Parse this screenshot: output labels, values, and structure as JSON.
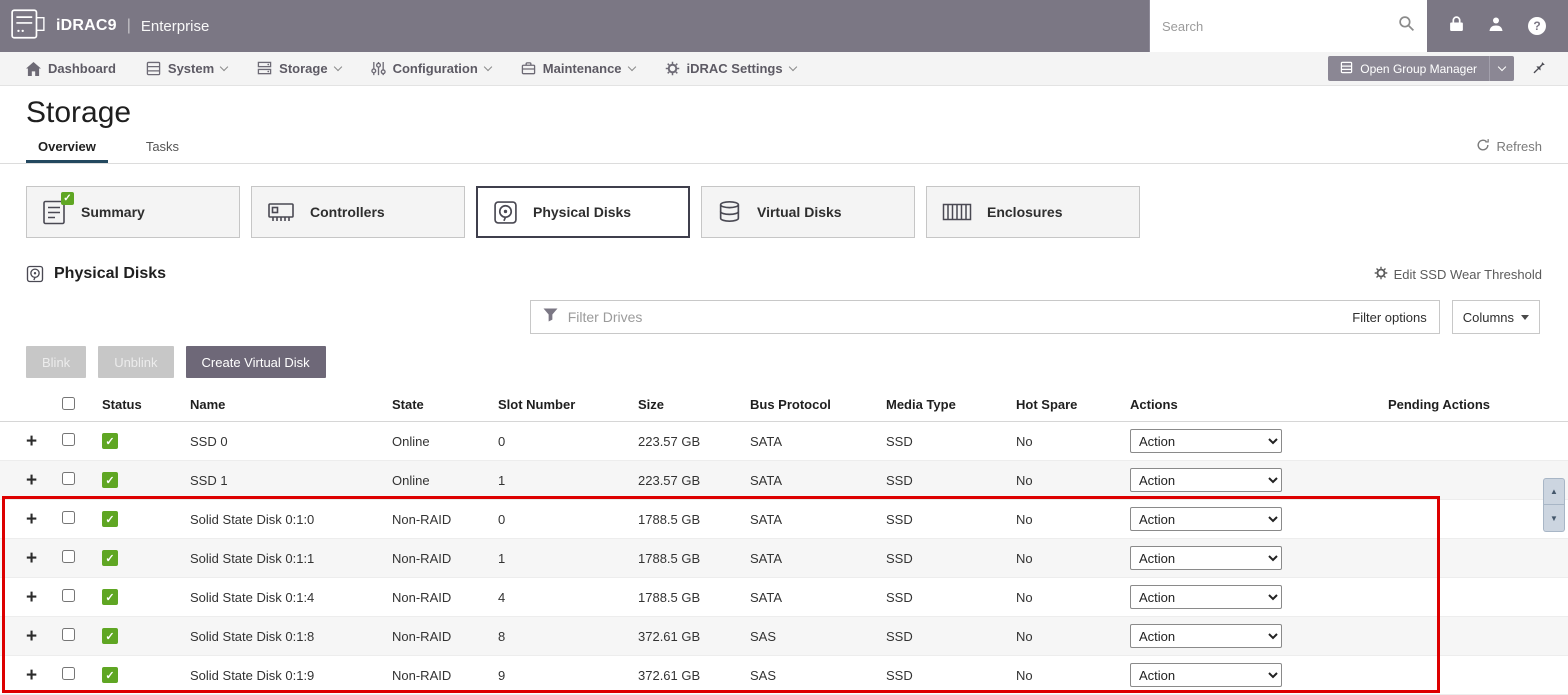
{
  "topbar": {
    "brand": "iDRAC9",
    "separator": "|",
    "edition": "Enterprise",
    "search_placeholder": "Search"
  },
  "nav": {
    "items": [
      {
        "label": "Dashboard",
        "icon": "home-icon",
        "has_dropdown": false
      },
      {
        "label": "System",
        "icon": "system-icon",
        "has_dropdown": true
      },
      {
        "label": "Storage",
        "icon": "storage-icon",
        "has_dropdown": true
      },
      {
        "label": "Configuration",
        "icon": "configuration-icon",
        "has_dropdown": true
      },
      {
        "label": "Maintenance",
        "icon": "maintenance-icon",
        "has_dropdown": true
      },
      {
        "label": "iDRAC Settings",
        "icon": "gear-icon",
        "has_dropdown": true
      }
    ],
    "open_group_manager_label": "Open Group Manager"
  },
  "page": {
    "title": "Storage",
    "tabs": [
      {
        "label": "Overview",
        "active": true
      },
      {
        "label": "Tasks",
        "active": false
      }
    ],
    "refresh_label": "Refresh"
  },
  "cards": [
    {
      "label": "Summary",
      "icon": "summary-icon",
      "status_badge": true,
      "selected": false
    },
    {
      "label": "Controllers",
      "icon": "controllers-icon",
      "status_badge": false,
      "selected": false
    },
    {
      "label": "Physical Disks",
      "icon": "physical-disks-icon",
      "status_badge": false,
      "selected": true
    },
    {
      "label": "Virtual Disks",
      "icon": "virtual-disks-icon",
      "status_badge": false,
      "selected": false
    },
    {
      "label": "Enclosures",
      "icon": "enclosures-icon",
      "status_badge": false,
      "selected": false
    }
  ],
  "section": {
    "title": "Physical Disks",
    "edit_ssd_wear_threshold_label": "Edit SSD Wear Threshold"
  },
  "filter": {
    "placeholder": "Filter Drives",
    "options_label": "Filter options",
    "columns_label": "Columns"
  },
  "toolbar": {
    "blink_label": "Blink",
    "unblink_label": "Unblink",
    "create_virtual_disk_label": "Create Virtual Disk"
  },
  "table": {
    "headers": [
      "Status",
      "Name",
      "State",
      "Slot Number",
      "Size",
      "Bus Protocol",
      "Media Type",
      "Hot Spare",
      "Actions",
      "Pending Actions"
    ],
    "action_select_value": "Action",
    "rows": [
      {
        "status": "ok",
        "name": "SSD 0",
        "state": "Online",
        "slot_number": "0",
        "size": "223.57 GB",
        "bus_protocol": "SATA",
        "media_type": "SSD",
        "hot_spare": "No",
        "action": "Action",
        "pending_actions": ""
      },
      {
        "status": "ok",
        "name": "SSD 1",
        "state": "Online",
        "slot_number": "1",
        "size": "223.57 GB",
        "bus_protocol": "SATA",
        "media_type": "SSD",
        "hot_spare": "No",
        "action": "Action",
        "pending_actions": ""
      },
      {
        "status": "ok",
        "name": "Solid State Disk 0:1:0",
        "state": "Non-RAID",
        "slot_number": "0",
        "size": "1788.5 GB",
        "bus_protocol": "SATA",
        "media_type": "SSD",
        "hot_spare": "No",
        "action": "Action",
        "pending_actions": ""
      },
      {
        "status": "ok",
        "name": "Solid State Disk 0:1:1",
        "state": "Non-RAID",
        "slot_number": "1",
        "size": "1788.5 GB",
        "bus_protocol": "SATA",
        "media_type": "SSD",
        "hot_spare": "No",
        "action": "Action",
        "pending_actions": ""
      },
      {
        "status": "ok",
        "name": "Solid State Disk 0:1:4",
        "state": "Non-RAID",
        "slot_number": "4",
        "size": "1788.5 GB",
        "bus_protocol": "SATA",
        "media_type": "SSD",
        "hot_spare": "No",
        "action": "Action",
        "pending_actions": ""
      },
      {
        "status": "ok",
        "name": "Solid State Disk 0:1:8",
        "state": "Non-RAID",
        "slot_number": "8",
        "size": "372.61 GB",
        "bus_protocol": "SAS",
        "media_type": "SSD",
        "hot_spare": "No",
        "action": "Action",
        "pending_actions": ""
      },
      {
        "status": "ok",
        "name": "Solid State Disk 0:1:9",
        "state": "Non-RAID",
        "slot_number": "9",
        "size": "372.61 GB",
        "bus_protocol": "SAS",
        "media_type": "SSD",
        "hot_spare": "No",
        "action": "Action",
        "pending_actions": ""
      }
    ]
  },
  "annotation": {
    "highlight_color": "#dd0000"
  },
  "colors": {
    "topbar_bg": "#7b7784",
    "tab_underline": "#23485f",
    "status_green": "#5fa623",
    "primary_button_bg": "#6e6878"
  },
  "icons": {
    "logo": "server-rack",
    "search": "magnifier",
    "lock": "padlock",
    "user": "person-silhouette",
    "help": "question-circle",
    "refresh": "circular-arrow",
    "filter": "funnel",
    "pin": "pushpin",
    "status_ok": "green-check"
  }
}
